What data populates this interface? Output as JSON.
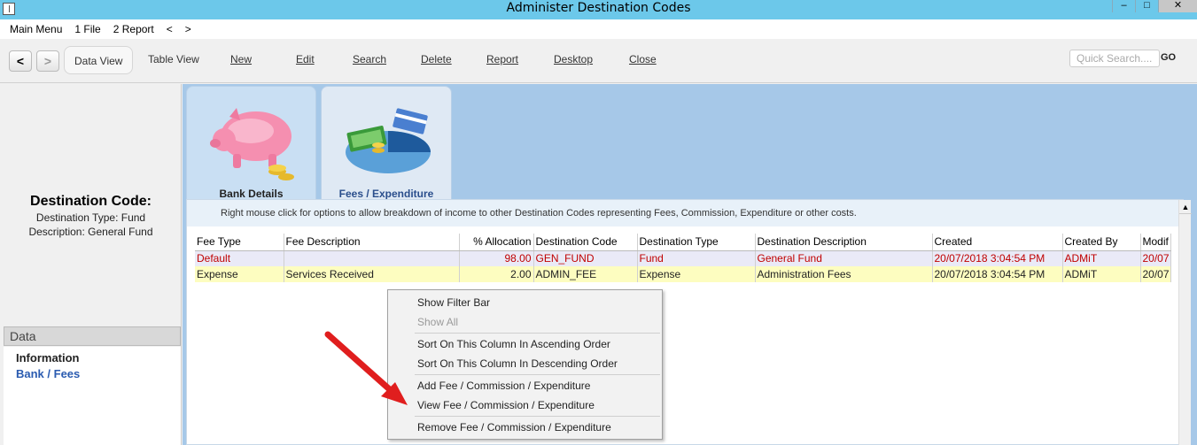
{
  "window": {
    "title": "Administer Destination Codes",
    "minimize": "–",
    "maximize": "□",
    "close": "✕"
  },
  "menu": [
    "Main Menu",
    "1 File",
    "2 Report",
    "<",
    ">"
  ],
  "toolbar": {
    "back": "<",
    "forward": ">",
    "data_view": "Data View",
    "table_view": "Table View",
    "new": "New",
    "edit": "Edit",
    "search": "Search",
    "delete": "Delete",
    "report": "Report",
    "desktop": "Desktop",
    "close": "Close",
    "quick_search_placeholder": "Quick Search....",
    "go": "GO"
  },
  "sidebar": {
    "heading": "Destination Code:",
    "type_line": "Destination Type: Fund",
    "desc_line": "Description: General Fund",
    "section": "Data",
    "items": [
      "Information",
      "Bank / Fees"
    ]
  },
  "tabs": {
    "bank": "Bank Details",
    "fees": "Fees / Expenditure",
    "bank_icon": "piggy-bank-icon",
    "fees_icon": "money-pie-chart-icon"
  },
  "hint": "Right mouse click for options to allow breakdown of income to other Destination Codes representing Fees, Commission, Expenditure or other costs.",
  "grid": {
    "columns": [
      "Fee Type",
      "Fee Description",
      "% Allocation",
      "Destination Code",
      "Destination Type",
      "Destination Description",
      "Created",
      "Created By",
      "Modif"
    ],
    "rows": [
      [
        "Default",
        "",
        "98.00",
        "GEN_FUND",
        "Fund",
        "General Fund",
        "20/07/2018 3:04:54 PM",
        "ADMiT",
        "20/07"
      ],
      [
        "Expense",
        "Services Received",
        "2.00",
        "ADMIN_FEE",
        "Expense",
        "Administration Fees",
        "20/07/2018 3:04:54 PM",
        "ADMiT",
        "20/07"
      ]
    ]
  },
  "context_menu": {
    "show_filter_bar": "Show Filter Bar",
    "show_all": "Show All",
    "sort_asc": "Sort On This Column In Ascending Order",
    "sort_desc": "Sort On This Column In Descending Order",
    "add_fee": "Add Fee / Commission / Expenditure",
    "view_fee": "View Fee / Commission / Expenditure",
    "remove_fee": "Remove Fee / Commission / Expenditure"
  },
  "colors": {
    "titlebar": "#6cc8ea",
    "content_bg": "#a6c8e8",
    "default_row_text": "#c00000",
    "expense_row_bg": "#fdfdc0",
    "annotation_arrow": "#e01e1e"
  }
}
